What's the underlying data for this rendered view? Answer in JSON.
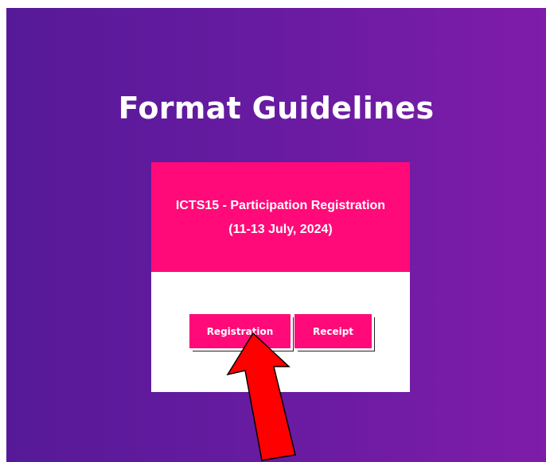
{
  "page": {
    "title": "Format Guidelines"
  },
  "card": {
    "heading_line1": "ICTS15 - Participation Registration",
    "heading_line2": "(11-13 July, 2024)",
    "buttons": {
      "registration": "Registration",
      "receipt": "Receipt"
    }
  },
  "colors": {
    "background_start": "#561a98",
    "background_end": "#7f1caa",
    "accent": "#ff0a78",
    "annotation_arrow": "#ff0000"
  },
  "annotation": {
    "icon": "red-arrow-icon"
  }
}
